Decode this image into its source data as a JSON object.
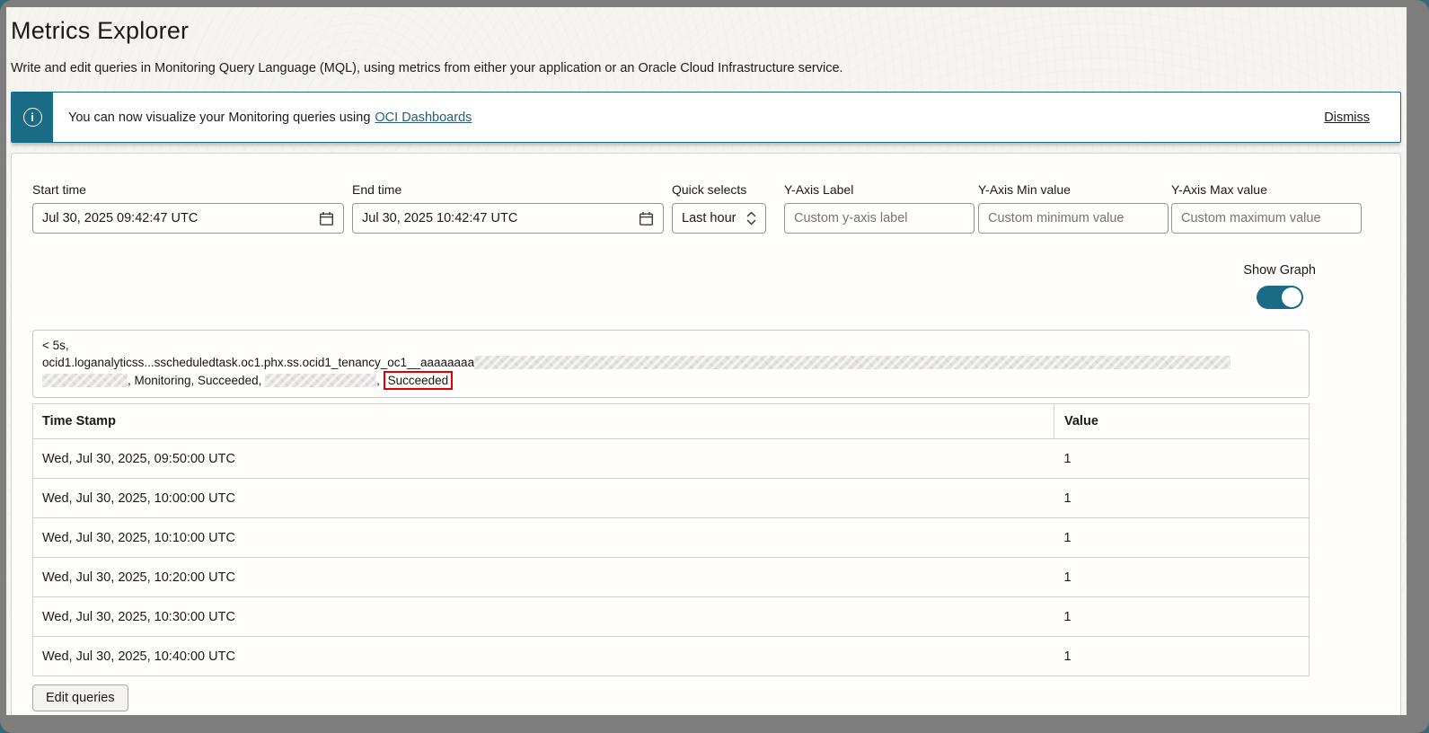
{
  "page": {
    "title": "Metrics Explorer",
    "subtitle": "Write and edit queries in Monitoring Query Language (MQL), using metrics from either your application or an Oracle Cloud Infrastructure service."
  },
  "colors": {
    "accent_teal": "#1a6b85",
    "highlight_red": "#e00000"
  },
  "banner": {
    "message": "You can now visualize your Monitoring queries using",
    "link_label": "OCI Dashboards",
    "dismiss_label": "Dismiss"
  },
  "form": {
    "start_time": {
      "label": "Start time",
      "value": "Jul 30, 2025 09:42:47 UTC"
    },
    "end_time": {
      "label": "End time",
      "value": "Jul 30, 2025 10:42:47 UTC"
    },
    "quick_selects": {
      "label": "Quick selects",
      "value": "Last hour"
    },
    "y_axis_label": {
      "label": "Y-Axis Label",
      "placeholder": "Custom y-axis label"
    },
    "y_axis_min": {
      "label": "Y-Axis Min value",
      "placeholder": "Custom minimum value"
    },
    "y_axis_max": {
      "label": "Y-Axis Max value",
      "placeholder": "Custom maximum value"
    },
    "show_graph": {
      "label": "Show Graph",
      "state": "on"
    }
  },
  "query_preview": {
    "line1": "< 5s,",
    "line2_text": "ocid1.loganalyticss...sscheduledtask.oc1.phx.ss.ocid1_tenancy_oc1__aaaaaaaa",
    "line3_text_a": ", Monitoring, Succeeded,",
    "line3_text_b": ",",
    "line3_highlight": "Succeeded"
  },
  "table": {
    "columns": [
      "Time Stamp",
      "Value"
    ],
    "rows": [
      {
        "timestamp": "Wed, Jul 30, 2025, 09:50:00 UTC",
        "value": "1"
      },
      {
        "timestamp": "Wed, Jul 30, 2025, 10:00:00 UTC",
        "value": "1"
      },
      {
        "timestamp": "Wed, Jul 30, 2025, 10:10:00 UTC",
        "value": "1"
      },
      {
        "timestamp": "Wed, Jul 30, 2025, 10:20:00 UTC",
        "value": "1"
      },
      {
        "timestamp": "Wed, Jul 30, 2025, 10:30:00 UTC",
        "value": "1"
      },
      {
        "timestamp": "Wed, Jul 30, 2025, 10:40:00 UTC",
        "value": "1"
      }
    ]
  },
  "actions": {
    "edit_queries_label": "Edit queries"
  }
}
